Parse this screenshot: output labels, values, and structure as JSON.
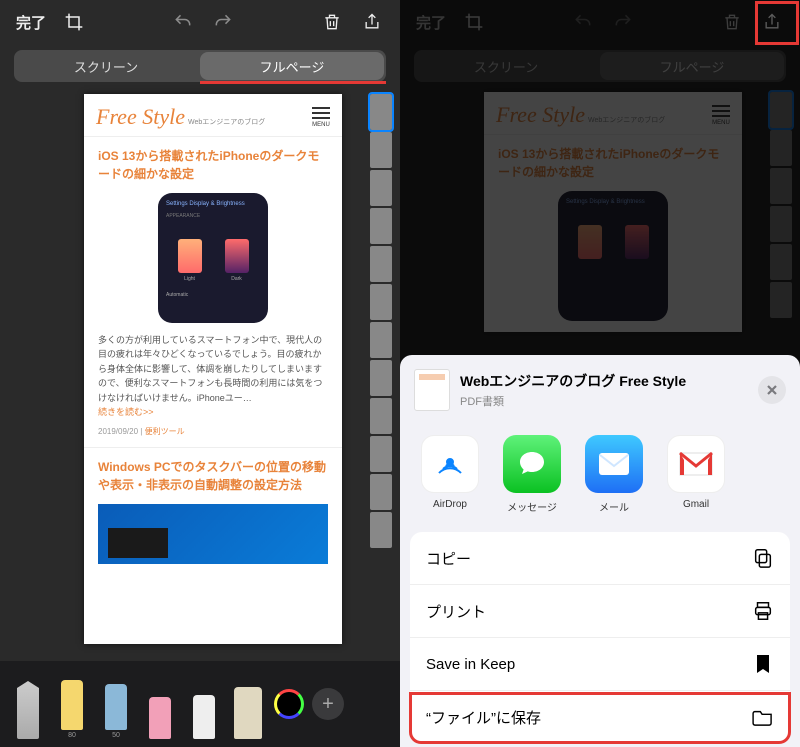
{
  "toolbar": {
    "done": "完了"
  },
  "segmented": {
    "screen": "スクリーン",
    "fullpage": "フルページ"
  },
  "preview": {
    "logo": "Free Style",
    "logo_sub": "Webエンジニアのブログ",
    "menu": "MENU",
    "article1_title": "iOS 13から搭載されたiPhoneのダークモードの細かな設定",
    "img_settings": "Settings  Display & Brightness",
    "img_appearance": "APPEARANCE",
    "img_light": "Light",
    "img_dark": "Dark",
    "img_auto": "Automatic",
    "article1_body": "多くの方が利用しているスマートフォン中で、現代人の目の疲れは年々ひどくなっているでしょう。目の疲れから身体全体に影響して、体調を崩したりしてしまいますので、便利なスマートフォンも長時間の利用には気をつけなければいけません。iPhoneユー…",
    "read_more": "続きを読む>>",
    "date": "2019/09/20",
    "category": "便利ツール",
    "article2_title": "Windows PCでのタスクバーの位置の移動や表示・非表示の自動調整の設定方法"
  },
  "tools": {
    "t1": "",
    "t2": "80",
    "t3": "50",
    "t4": "",
    "t5": "",
    "t6": ""
  },
  "share": {
    "title": "Webエンジニアのブログ  Free Style",
    "subtitle": "PDF書類",
    "apps": {
      "airdrop": "AirDrop",
      "message": "メッセージ",
      "mail": "メール",
      "gmail": "Gmail"
    },
    "actions": {
      "copy": "コピー",
      "print": "プリント",
      "keep": "Save in Keep",
      "files": "“ファイル”に保存"
    }
  }
}
